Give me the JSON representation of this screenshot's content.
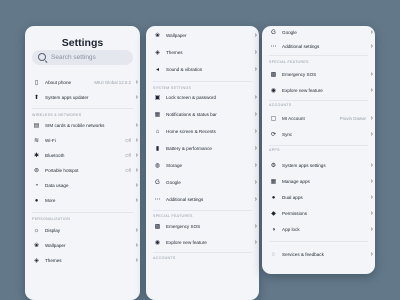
{
  "colors": {
    "background": "#63798a",
    "card": "#f3f5f8",
    "text": "#1d2430",
    "muted": "#9aa2ae"
  },
  "screen1": {
    "title": "Settings",
    "search_placeholder": "Search settings",
    "about_phone": {
      "label": "About phone",
      "value": "MIUI Global 12.0.2"
    },
    "system_apps_updater": "System apps updater",
    "section_wireless": "WIRELESS & NETWORKS",
    "sim_cards": "SIM cards & mobile networks",
    "wifi": {
      "label": "Wi-Fi",
      "value": "Off"
    },
    "bluetooth": {
      "label": "Bluetooth",
      "value": "Off"
    },
    "hotspot": {
      "label": "Portable hotspot",
      "value": "Off"
    },
    "data_usage": "Data usage",
    "more": "More",
    "section_personalization": "PERSONALIZATION",
    "display": "Display",
    "wallpaper": "Wallpaper",
    "themes": "Themes"
  },
  "screen2": {
    "wallpaper": "Wallpaper",
    "themes": "Themes",
    "sound": "Sound & vibration",
    "section_system": "SYSTEM SETTINGS",
    "lock_screen": "Lock screen & password",
    "notifications": "Notifications & status bar",
    "home_screen": "Home screen & Recents",
    "battery": "Battery & performance",
    "storage": "Storage",
    "google": "Google",
    "additional": "Additional settings",
    "section_special": "SPECIAL FEATURES",
    "emergency": "Emergency SOS",
    "explore": "Explore new feature",
    "section_accounts": "ACCOUNTS"
  },
  "screen3": {
    "google": "Google",
    "additional": "Additional settings",
    "section_special": "SPECIAL FEATURES",
    "emergency": "Emergency SOS",
    "explore": "Explore new feature",
    "section_accounts": "ACCOUNTS",
    "mi_account": {
      "label": "MI Account",
      "value": "Pravin Dawar"
    },
    "sync": "Sync",
    "section_apps": "APPS",
    "system_apps_settings": "System apps settings",
    "manage_apps": "Manage apps",
    "dual_apps": "Dual apps",
    "permissions": "Permissions",
    "app_lock": "App lock",
    "services": "Services & feedback"
  }
}
